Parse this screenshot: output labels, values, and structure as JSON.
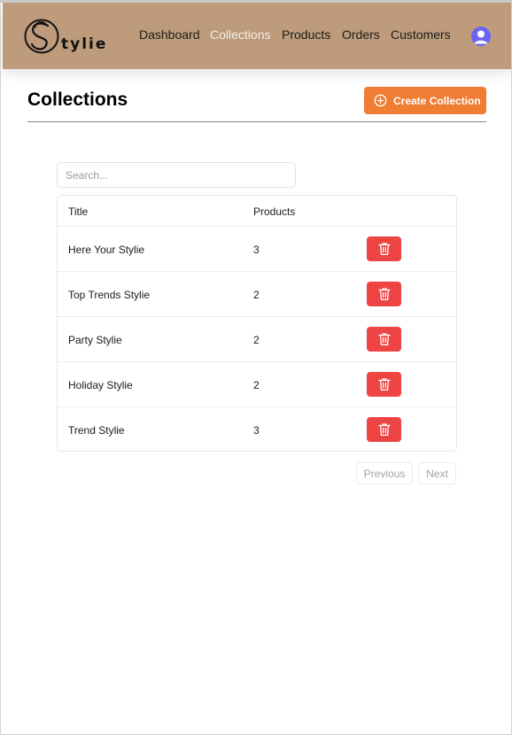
{
  "brand": {
    "logo_text": "tylie",
    "logo_icon": "s-swirl-logo"
  },
  "nav": {
    "links": [
      {
        "label": "Dashboard",
        "active": false
      },
      {
        "label": "Collections",
        "active": true
      },
      {
        "label": "Products",
        "active": false
      },
      {
        "label": "Orders",
        "active": false
      },
      {
        "label": "Customers",
        "active": false
      }
    ],
    "avatar_icon": "user-avatar-icon"
  },
  "page": {
    "title": "Collections",
    "create_button_label": "Create Collection",
    "create_button_icon": "plus-circle-icon"
  },
  "search": {
    "placeholder": "Search...",
    "value": ""
  },
  "table": {
    "columns": [
      "Title",
      "Products"
    ],
    "rows": [
      {
        "title": "Here Your Stylie",
        "products": "3"
      },
      {
        "title": "Top Trends Stylie",
        "products": "2"
      },
      {
        "title": "Party Stylie",
        "products": "2"
      },
      {
        "title": "Holiday Stylie",
        "products": "2"
      },
      {
        "title": "Trend Stylie",
        "products": "3"
      }
    ],
    "row_action_icon": "trash-icon"
  },
  "pagination": {
    "previous_label": "Previous",
    "next_label": "Next"
  },
  "colors": {
    "navbar": "#bd9b7b",
    "accent": "#ef7d33",
    "danger": "#ef4444",
    "avatar": "#6b63f3",
    "active_nav": "#f3ede6"
  }
}
